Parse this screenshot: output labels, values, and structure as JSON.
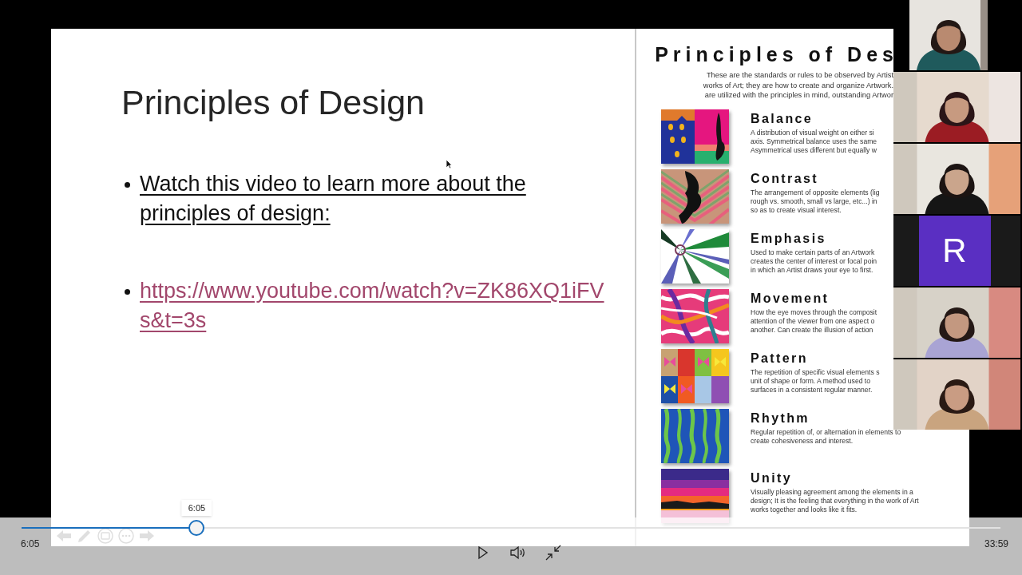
{
  "slide": {
    "title": "Principles of Design",
    "bullets": [
      {
        "kind": "text",
        "text": "Watch this video to learn more about the principles of design:"
      },
      {
        "kind": "link",
        "text": "https://www.youtube.com/watch?v=ZK86XQ1iFVs&t=3s"
      }
    ],
    "poster": {
      "title": "Principles of Des",
      "intro": [
        "These are the standards or rules to be observed by Artist",
        "works of Art; they are how to create and organize Artwork.",
        "are utilized with the principles in mind, outstanding Artwor"
      ],
      "principles": [
        {
          "name": "Balance",
          "description": [
            "A distribution of visual weight on either si",
            "axis.  Symmetrical balance uses the same",
            "Asymmetrical uses different but equally w"
          ]
        },
        {
          "name": "Contrast",
          "description": [
            "The arrangement of opposite elements (lig",
            "rough vs. smooth, small vs large, etc...) in",
            "so as to create visual interest."
          ]
        },
        {
          "name": "Emphasis",
          "description": [
            "Used to make certain parts of an Artwork",
            "creates the center of interest or focal poin",
            "in which an Artist draws your eye to first."
          ]
        },
        {
          "name": "Movement",
          "description": [
            "How the eye moves through the composit",
            "attention of the viewer from one aspect o",
            "another.  Can create the illusion of action"
          ]
        },
        {
          "name": "Pattern",
          "description": [
            "The repetition of specific visual elements s",
            "unit of shape or form.  A method used to",
            "surfaces in a consistent regular manner."
          ]
        },
        {
          "name": "Rhythm",
          "description": [
            "Regular repetition of, or alternation in elements to",
            "create cohesiveness and interest."
          ]
        },
        {
          "name": "Unity",
          "description": [
            "Visually pleasing agreement among the elements in a",
            "design; It is the feeling that everything in the work of Art",
            "works together and looks like it fits."
          ]
        }
      ]
    }
  },
  "participants": [
    {
      "kind": "picture"
    },
    {
      "kind": "picture"
    },
    {
      "kind": "picture"
    },
    {
      "kind": "avatar",
      "initial": "R"
    },
    {
      "kind": "picture"
    },
    {
      "kind": "picture"
    }
  ],
  "player": {
    "tooltip": "6:05",
    "elapsed": "6:05",
    "duration": "33:59",
    "progress": {
      "level": 0.179
    }
  }
}
